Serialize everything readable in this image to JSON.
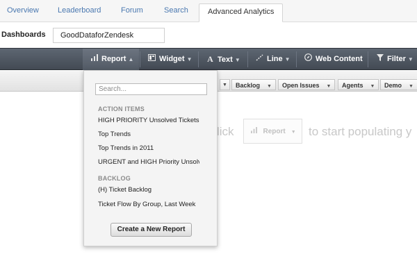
{
  "topnav": {
    "tabs": [
      {
        "label": "Overview"
      },
      {
        "label": "Leaderboard"
      },
      {
        "label": "Forum"
      },
      {
        "label": "Search"
      },
      {
        "label": "Advanced Analytics",
        "active": true
      }
    ]
  },
  "dashboards": {
    "label": "Dashboards",
    "current": "GoodDataforZendesk"
  },
  "toolbar": {
    "report": {
      "label": "Report",
      "icon": "bar-chart-icon",
      "caret": "▲"
    },
    "widget": {
      "label": "Widget",
      "icon": "widget-icon",
      "caret": "▼"
    },
    "text": {
      "label": "Text",
      "icon": "text-icon",
      "caret": "▼"
    },
    "line": {
      "label": "Line",
      "icon": "line-icon",
      "caret": "▼"
    },
    "web_content": {
      "label": "Web Content",
      "icon": "compass-icon"
    },
    "filter": {
      "label": "Filter",
      "icon": "funnel-icon",
      "caret": "▼"
    }
  },
  "filters": [
    {
      "label": "Backlog"
    },
    {
      "label": "Open Issues"
    },
    {
      "label": "Agents"
    },
    {
      "label": "Demo"
    }
  ],
  "hint": {
    "prefix": "lick",
    "button": "Report",
    "suffix": "to start populating y"
  },
  "dropdown": {
    "search_placeholder": "Search...",
    "sections": [
      {
        "title": "ACTION ITEMS",
        "items": [
          "HIGH PRIORITY Unsolved Tickets",
          "Top Trends",
          "Top Trends in 2011",
          "URGENT and HIGH Priority Unsolved"
        ]
      },
      {
        "title": "BACKLOG",
        "items": [
          "(H) Ticket Backlog",
          "Ticket Flow By Group, Last Week"
        ]
      }
    ],
    "create_button": "Create a New Report"
  }
}
